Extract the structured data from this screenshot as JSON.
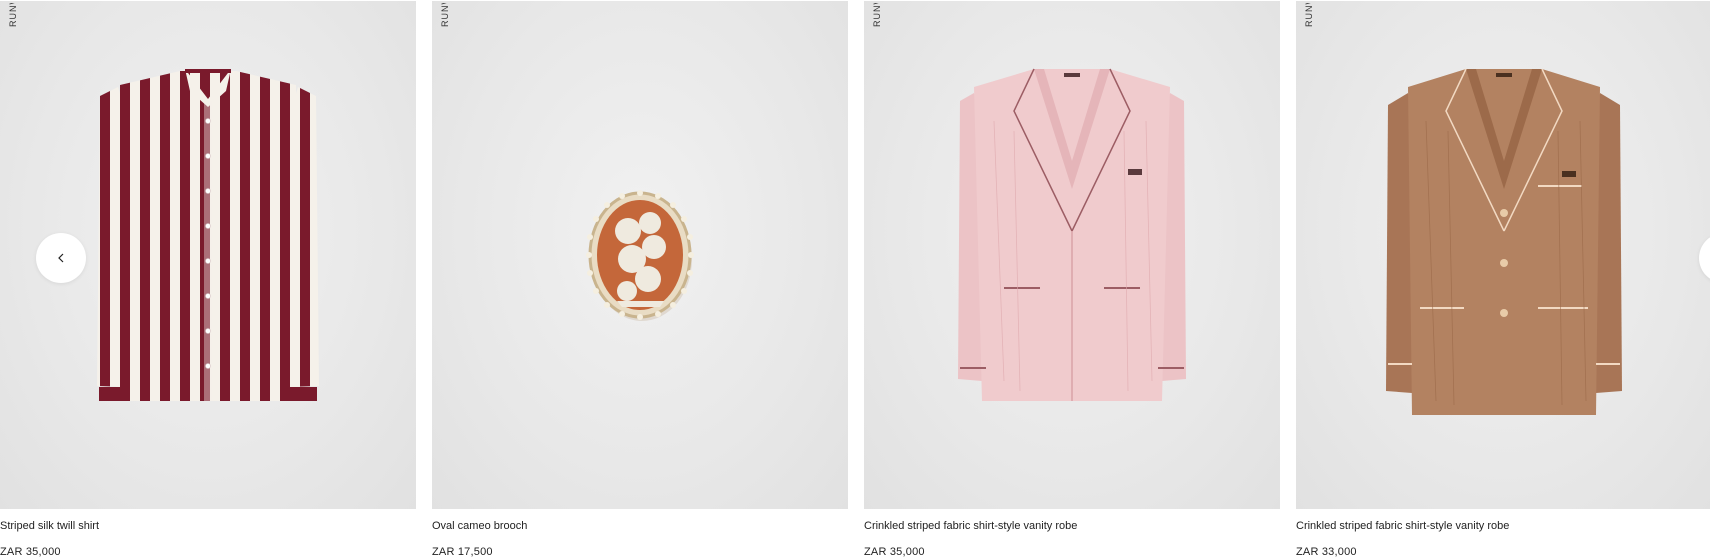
{
  "carousel": {
    "runway_label": "RUNWAY",
    "prev_icon": "chevron-left-icon",
    "next_icon": "chevron-right-icon",
    "items": [
      {
        "name": "Striped silk twill shirt",
        "price": "ZAR 35,000",
        "image": "striped-shirt"
      },
      {
        "name": "Oval cameo brooch",
        "price": "ZAR 17,500",
        "image": "cameo-brooch"
      },
      {
        "name": "Crinkled striped fabric shirt-style vanity robe",
        "price": "ZAR 35,000",
        "image": "pink-robe"
      },
      {
        "name": "Crinkled striped fabric shirt-style vanity robe",
        "price": "ZAR 33,000",
        "image": "brown-robe"
      }
    ]
  },
  "colors": {
    "burgundy": "#7a1a2c",
    "pink": "#ecc3c6",
    "tan": "#b07f5d",
    "background": "#ececec"
  }
}
